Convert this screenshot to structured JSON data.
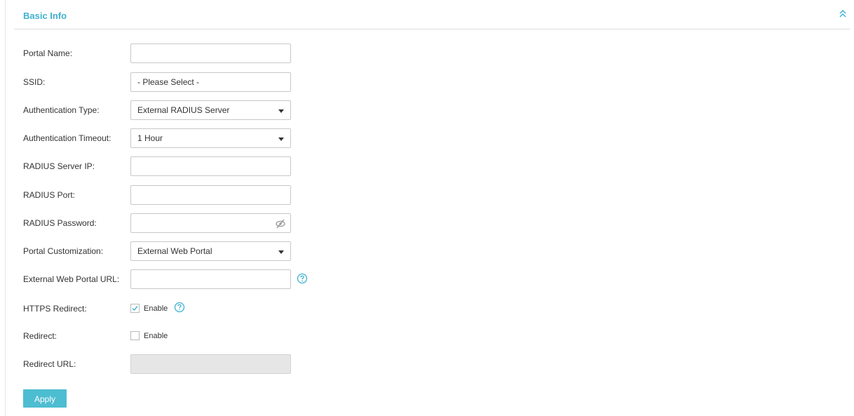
{
  "section": {
    "title": "Basic Info"
  },
  "form": {
    "portal_name": {
      "label": "Portal Name:",
      "value": ""
    },
    "ssid": {
      "label": "SSID:",
      "value": "- Please Select -"
    },
    "auth_type": {
      "label": "Authentication Type:",
      "value": "External RADIUS Server"
    },
    "auth_timeout": {
      "label": "Authentication Timeout:",
      "value": "1 Hour"
    },
    "radius_ip": {
      "label": "RADIUS Server IP:",
      "value": ""
    },
    "radius_port": {
      "label": "RADIUS Port:",
      "value": ""
    },
    "radius_password": {
      "label": "RADIUS Password:",
      "value": ""
    },
    "portal_customization": {
      "label": "Portal Customization:",
      "value": "External Web Portal"
    },
    "external_url": {
      "label": "External Web Portal URL:",
      "value": ""
    },
    "https_redirect": {
      "label": "HTTPS Redirect:",
      "checkbox_label": "Enable",
      "checked": true
    },
    "redirect": {
      "label": "Redirect:",
      "checkbox_label": "Enable",
      "checked": false
    },
    "redirect_url": {
      "label": "Redirect URL:",
      "value": ""
    }
  },
  "buttons": {
    "apply": "Apply"
  },
  "colors": {
    "accent": "#3fb1d1",
    "button": "#4dbdd1",
    "disabled_field": "#e6e6e6"
  },
  "icons": {
    "collapse": "double-chevron-up-icon",
    "password_toggle": "eye-slash-icon",
    "help": "question-circle-icon",
    "select": "caret-down-icon"
  }
}
